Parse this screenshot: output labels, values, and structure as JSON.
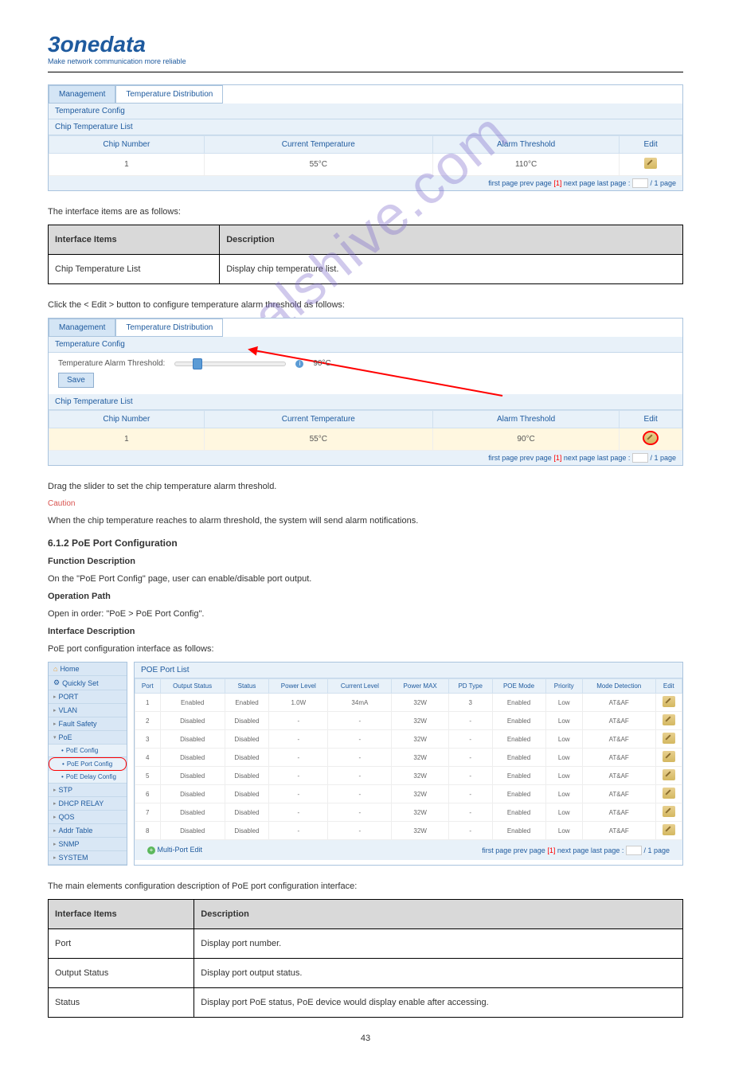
{
  "logo": {
    "title": "3onedata",
    "subtitle": "Make network communication more reliable"
  },
  "tabs": {
    "t1": "Management",
    "t2": "Temperature Distribution"
  },
  "panel1": {
    "header1": "Temperature Config",
    "header2": "Chip Temperature List",
    "cols": {
      "c1": "Chip Number",
      "c2": "Current Temperature",
      "c3": "Alarm Threshold",
      "c4": "Edit"
    },
    "row": {
      "c1": "1",
      "c2": "55°C",
      "c3": "110°C"
    }
  },
  "pagination": {
    "first": "first page",
    "prev": "prev page",
    "cur": "[1]",
    "next": "next page",
    "last": "last page :",
    "suffix": "/ 1 page"
  },
  "desc1": {
    "heading_intro": "The interface items are as follows:",
    "h1": "Interface Items",
    "h2": "Description",
    "r1c1": "Chip Temperature List",
    "r1c2": "Display chip temperature list."
  },
  "text1": "Click the < Edit > button to configure temperature alarm threshold as follows:",
  "panel2": {
    "label": "Temperature Alarm Threshold:",
    "value": "90°C",
    "save": "Save",
    "row": {
      "c1": "1",
      "c2": "55°C",
      "c3": "90°C"
    }
  },
  "post_panel2": {
    "line1": "Drag the slider to set the chip temperature alarm threshold.",
    "caution": "Caution",
    "caution_body": "When the chip temperature reaches to alarm threshold, the system will send alarm notifications.",
    "heading": "6.1.2 PoE Port Configuration",
    "heading2": "Function Description",
    "body1": "On the \"PoE Port Config\" page, user can enable/disable port output.",
    "heading3": "Operation Path",
    "body2": "Open in order: \"PoE > PoE Port Config\".",
    "heading4": "Interface Description",
    "body3": "PoE port configuration interface as follows:"
  },
  "sidebar": {
    "home": "Home",
    "quick": "Quickly Set",
    "port": "PORT",
    "vlan": "VLAN",
    "fault": "Fault Safety",
    "poe": "PoE",
    "poe_conf": "PoE Config",
    "poe_port": "PoE Port Config",
    "poe_delay": "PoE Delay Config",
    "stp": "STP",
    "dhcp": "DHCP RELAY",
    "qos": "QOS",
    "addr": "Addr Table",
    "snmp": "SNMP",
    "system": "SYSTEM"
  },
  "poe": {
    "header": "POE Port List",
    "cols": {
      "port": "Port",
      "os": "Output Status",
      "st": "Status",
      "pl": "Power Level",
      "cl": "Current Level",
      "pm": "Power MAX",
      "pd": "PD Type",
      "pmode": "POE Mode",
      "pri": "Priority",
      "md": "Mode Detection",
      "edit": "Edit"
    },
    "rows": [
      {
        "port": "1",
        "os": "Enabled",
        "st": "Enabled",
        "pl": "1.0W",
        "cl": "34mA",
        "pm": "32W",
        "pd": "3",
        "pmode": "Enabled",
        "pri": "Low",
        "md": "AT&AF"
      },
      {
        "port": "2",
        "os": "Disabled",
        "st": "Disabled",
        "pl": "-",
        "cl": "-",
        "pm": "32W",
        "pd": "-",
        "pmode": "Enabled",
        "pri": "Low",
        "md": "AT&AF"
      },
      {
        "port": "3",
        "os": "Disabled",
        "st": "Disabled",
        "pl": "-",
        "cl": "-",
        "pm": "32W",
        "pd": "-",
        "pmode": "Enabled",
        "pri": "Low",
        "md": "AT&AF"
      },
      {
        "port": "4",
        "os": "Disabled",
        "st": "Disabled",
        "pl": "-",
        "cl": "-",
        "pm": "32W",
        "pd": "-",
        "pmode": "Enabled",
        "pri": "Low",
        "md": "AT&AF"
      },
      {
        "port": "5",
        "os": "Disabled",
        "st": "Disabled",
        "pl": "-",
        "cl": "-",
        "pm": "32W",
        "pd": "-",
        "pmode": "Enabled",
        "pri": "Low",
        "md": "AT&AF"
      },
      {
        "port": "6",
        "os": "Disabled",
        "st": "Disabled",
        "pl": "-",
        "cl": "-",
        "pm": "32W",
        "pd": "-",
        "pmode": "Enabled",
        "pri": "Low",
        "md": "AT&AF"
      },
      {
        "port": "7",
        "os": "Disabled",
        "st": "Disabled",
        "pl": "-",
        "cl": "-",
        "pm": "32W",
        "pd": "-",
        "pmode": "Enabled",
        "pri": "Low",
        "md": "AT&AF"
      },
      {
        "port": "8",
        "os": "Disabled",
        "st": "Disabled",
        "pl": "-",
        "cl": "-",
        "pm": "32W",
        "pd": "-",
        "pmode": "Enabled",
        "pri": "Low",
        "md": "AT&AF"
      }
    ],
    "multi": "Multi-Port Edit"
  },
  "desc2": {
    "intro": "The main elements configuration description of PoE port configuration interface:",
    "h1": "Interface Items",
    "h2": "Description",
    "r1c1": "Port",
    "r1c2": "Display port number.",
    "r2c1": "Output Status",
    "r2c2": "Display port output status.",
    "r3c1": "Status",
    "r3c2": "Display port PoE status, PoE device would display enable after accessing."
  },
  "page_num": "43"
}
